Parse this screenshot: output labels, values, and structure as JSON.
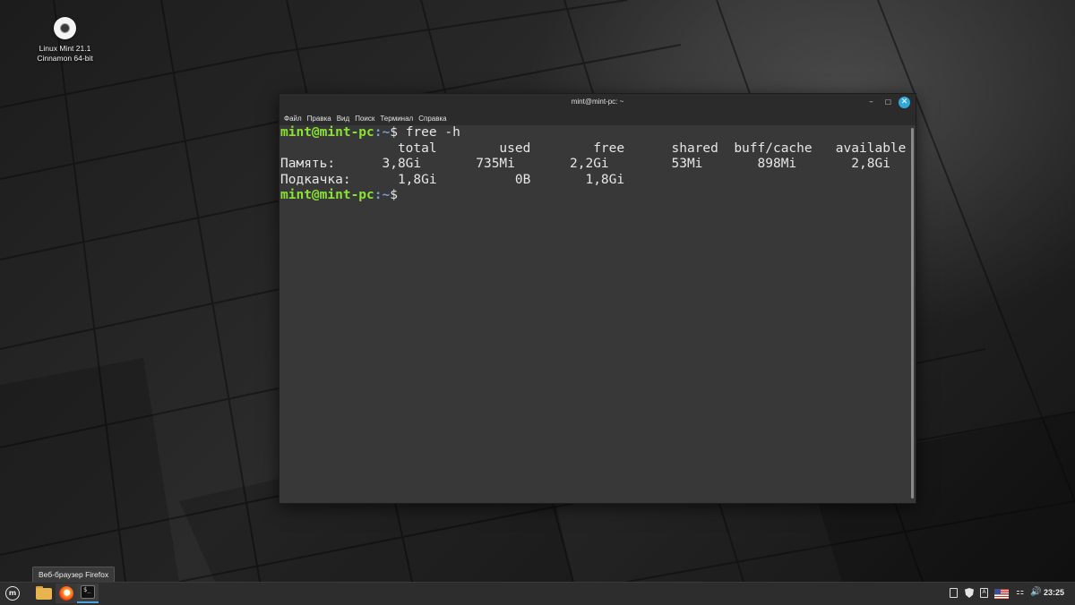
{
  "desktop": {
    "icon_line1": "Linux Mint 21.1",
    "icon_line2": "Cinnamon 64-bit"
  },
  "window": {
    "title": "mint@mint-pc: ~",
    "minimize_glyph": "–",
    "maximize_glyph": "☐",
    "close_glyph": "✕",
    "menu": [
      "Файл",
      "Правка",
      "Вид",
      "Поиск",
      "Терминал",
      "Справка"
    ]
  },
  "terminal": {
    "prompt_user_host": "mint@mint-pc",
    "prompt_path": ":~",
    "prompt_symbol": "$",
    "command": " free -h",
    "header_line": "               total        used        free      shared  buff/cache   available",
    "mem_line": "Память:      3,8Gi       735Mi       2,2Gi        53Mi       898Mi       2,8Gi",
    "swap_line": "Подкачка:      1,8Gi          0B       1,8Gi"
  },
  "tooltip": {
    "text": "Веб-браузер Firefox"
  },
  "taskbar": {
    "mint_menu_glyph": "m",
    "terminal_glyph": "$_",
    "network_glyph": "⚏",
    "volume_glyph": "🔊",
    "clock": "23:25",
    "update_glyph": "A"
  }
}
